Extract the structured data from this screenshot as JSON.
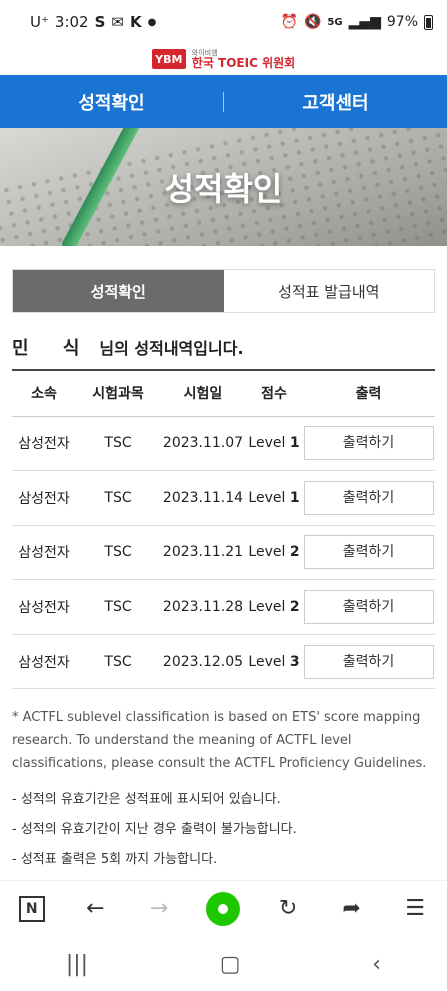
{
  "status_bar": {
    "carrier": "U⁺",
    "time": "3:02",
    "network": "5G",
    "battery": "97%"
  },
  "logo": {
    "mark": "YBM",
    "sub": "와이비엠",
    "main": "한국 TOEIC 위원회"
  },
  "top_nav": {
    "items": [
      {
        "label": "성적확인"
      },
      {
        "label": "고객센터"
      }
    ]
  },
  "hero": {
    "title": "성적확인"
  },
  "tabs": {
    "active": "성적확인",
    "inactive": "성적표 발급내역"
  },
  "greeting": {
    "name": "민 식",
    "suffix": "님의 성적내역입니다."
  },
  "table": {
    "headers": [
      "소속",
      "시험과목",
      "시험일",
      "점수",
      "출력"
    ],
    "rows": [
      {
        "org": "삼성전자",
        "subject": "TSC",
        "date": "2023.11.07",
        "level_prefix": "Level",
        "level_num": "1",
        "action": "출력하기"
      },
      {
        "org": "삼성전자",
        "subject": "TSC",
        "date": "2023.11.14",
        "level_prefix": "Level",
        "level_num": "1",
        "action": "출력하기"
      },
      {
        "org": "삼성전자",
        "subject": "TSC",
        "date": "2023.11.21",
        "level_prefix": "Level",
        "level_num": "2",
        "action": "출력하기"
      },
      {
        "org": "삼성전자",
        "subject": "TSC",
        "date": "2023.11.28",
        "level_prefix": "Level",
        "level_num": "2",
        "action": "출력하기"
      },
      {
        "org": "삼성전자",
        "subject": "TSC",
        "date": "2023.12.05",
        "level_prefix": "Level",
        "level_num": "3",
        "action": "출력하기"
      }
    ]
  },
  "notes": {
    "english": "* ACTFL sublevel classification is based on ETS' score mapping research. To understand the meaning of ACTFL level classifications, please consult the ACTFL Proficiency Guidelines.",
    "korean": [
      "- 성적의 유효기간은 성적표에 표시되어 있습니다.",
      "- 성적의 유효기간이 지난 경우 출력이 불가능합니다.",
      "- 성적표 출력은 5회 까지 가능합니다."
    ]
  },
  "browser_bar": {
    "icons": [
      "naver-n-icon",
      "back-arrow-icon",
      "forward-arrow-icon",
      "home-green-icon",
      "refresh-icon",
      "share-icon",
      "menu-icon"
    ],
    "n_label": "N"
  },
  "colors": {
    "nav_blue": "#1a74d3",
    "tab_active": "#6b6b6b",
    "brand_red": "#d6252c",
    "home_green": "#1ec800"
  }
}
